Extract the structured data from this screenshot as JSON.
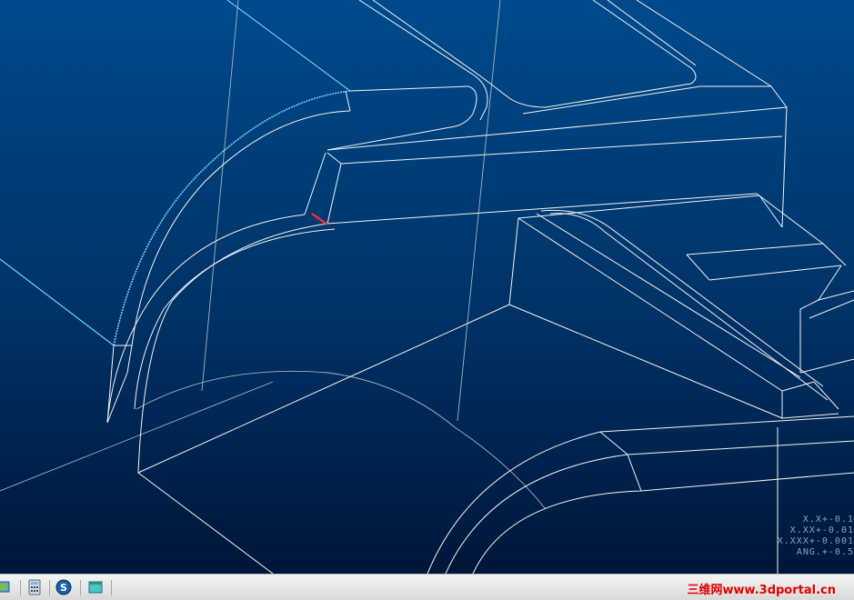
{
  "viewport": {
    "background_top": "#003f7a",
    "background_bottom": "#001a3a",
    "edge_color": "#f2f2f2",
    "hidden_edge_color": "#9fb3c4",
    "preselect_color": "#6fd3ff",
    "selected_edge_color": "#ff2a2a"
  },
  "tolerance_table": {
    "lines": [
      "X.X+-0.1",
      "X.XX+-0.01",
      "X.XXX+-0.001",
      "ANG.+-0.5"
    ]
  },
  "taskbar": {
    "background": "#e6e6e6",
    "buttons": [
      {
        "name": "show-desktop-icon"
      },
      {
        "name": "calculator-icon"
      },
      {
        "name": "app-s-icon"
      },
      {
        "name": "window-icon"
      }
    ],
    "watermark": "三维网www.3dportal.cn",
    "watermark_color": "#e30000"
  }
}
